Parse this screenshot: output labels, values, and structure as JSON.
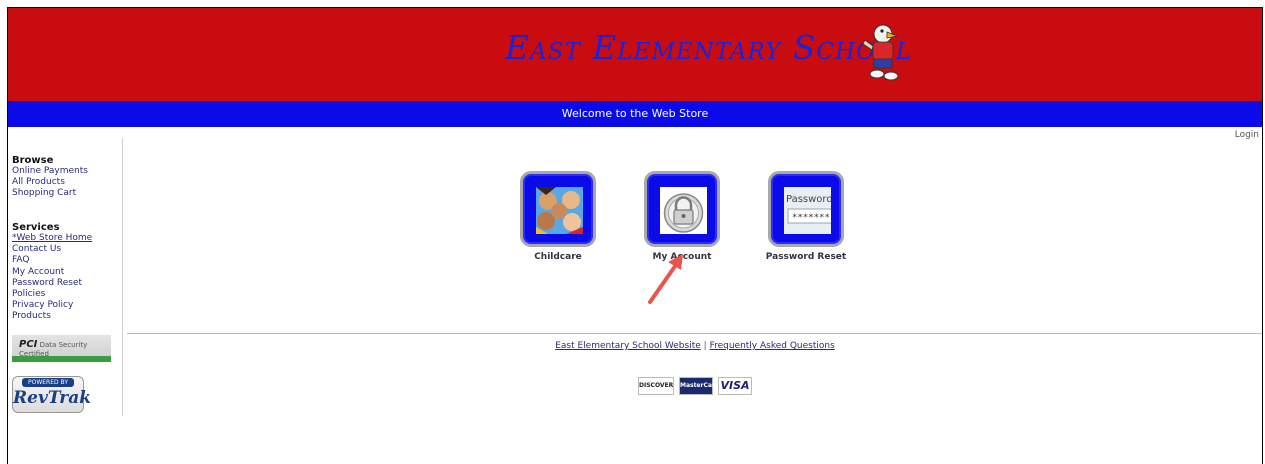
{
  "header": {
    "site_title": "East Elementary School",
    "colors": {
      "header_red": "#c90c0f",
      "welcome_blue": "#0b0be9",
      "title_blue": "#1b23d8"
    }
  },
  "welcome_bar": {
    "text": "Welcome to the Web Store"
  },
  "top_links": {
    "login": "Login"
  },
  "sidebar": {
    "browse": {
      "heading": "Browse",
      "items": [
        "Online Payments",
        "All Products",
        "Shopping Cart"
      ]
    },
    "services": {
      "heading": "Services",
      "items": [
        "*Web Store Home",
        "Contact Us",
        "FAQ",
        "My Account",
        "Password Reset",
        "Policies",
        "Privacy Policy",
        "Products"
      ]
    },
    "badges": {
      "pci_mark": "PCI",
      "pci_text": "Data Security Certified",
      "revtrak_powered": "POWERED BY",
      "revtrak_name": "RevTrak"
    }
  },
  "tiles": [
    {
      "label": "Childcare",
      "icon": "children-photo-icon"
    },
    {
      "label": "My Account",
      "icon": "padlock-icon"
    },
    {
      "label": "Password Reset",
      "icon": "password-field-icon"
    }
  ],
  "tile_images": {
    "password_word": "Password:",
    "password_mask": "*******"
  },
  "footer": {
    "website_link": "East Elementary School Website",
    "separator": "|",
    "faq_link": "Frequently Asked Questions",
    "cards": [
      "DISCOVER",
      "MasterCard",
      "VISA"
    ]
  }
}
